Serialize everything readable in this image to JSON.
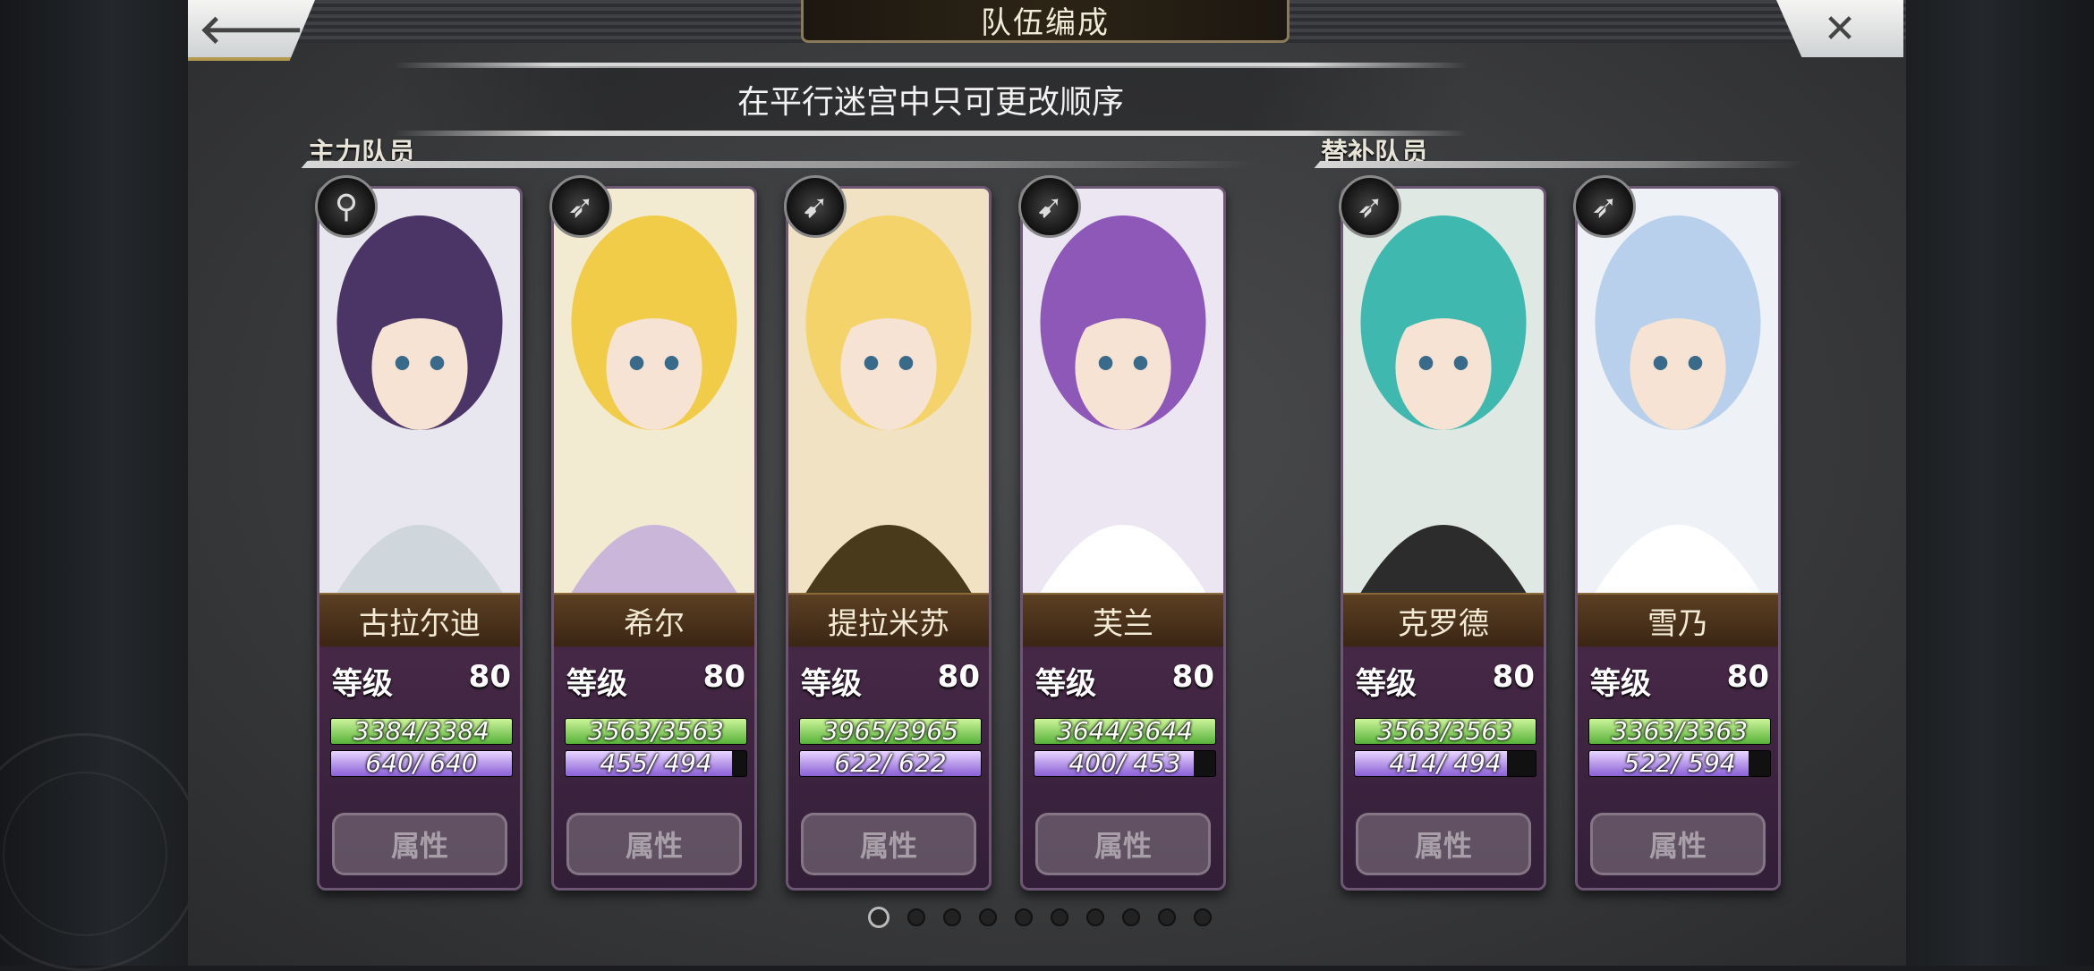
{
  "header": {
    "title": "队伍编成",
    "back_icon": "arrow-left-icon",
    "close_icon": "close-icon"
  },
  "notice": "在平行迷宫中只可更改顺序",
  "sections": {
    "main_label": "主力队员",
    "reserve_label": "替补队员"
  },
  "common": {
    "level_label": "等级",
    "attr_label": "属性"
  },
  "members": [
    {
      "name": "古拉尔迪",
      "weapon": "staff-icon",
      "level": "80",
      "hp": "3384/3384",
      "hp_ratio": 1.0,
      "mp": "640/ 640",
      "mp_ratio": 1.0
    },
    {
      "name": "希尔",
      "weapon": "bow-icon",
      "level": "80",
      "hp": "3563/3563",
      "hp_ratio": 1.0,
      "mp": "455/ 494",
      "mp_ratio": 0.92
    },
    {
      "name": "提拉米苏",
      "weapon": "spear-icon",
      "level": "80",
      "hp": "3965/3965",
      "hp_ratio": 1.0,
      "mp": "622/ 622",
      "mp_ratio": 1.0
    },
    {
      "name": "芙兰",
      "weapon": "spear-icon",
      "level": "80",
      "hp": "3644/3644",
      "hp_ratio": 1.0,
      "mp": "400/ 453",
      "mp_ratio": 0.88
    }
  ],
  "reserves": [
    {
      "name": "克罗德",
      "weapon": "bow-icon",
      "level": "80",
      "hp": "3563/3563",
      "hp_ratio": 1.0,
      "mp": "414/ 494",
      "mp_ratio": 0.84
    },
    {
      "name": "雪乃",
      "weapon": "bow-icon",
      "level": "80",
      "hp": "3363/3363",
      "hp_ratio": 1.0,
      "mp": "522/ 594",
      "mp_ratio": 0.88
    }
  ],
  "pagination": {
    "total": 10,
    "current": 1
  },
  "colors": {
    "hp": "#58b23a",
    "mp": "#8a5fd6",
    "name_bar": "#5b3f22"
  }
}
